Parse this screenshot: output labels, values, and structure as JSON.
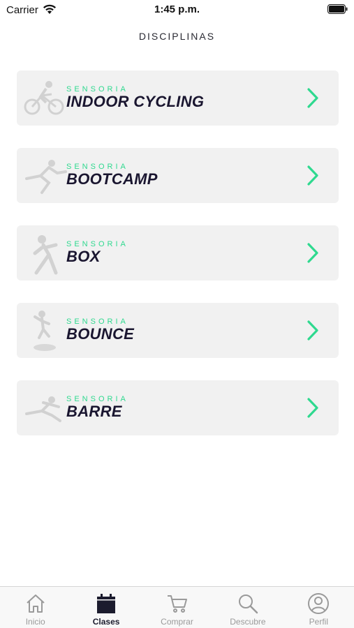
{
  "status_bar": {
    "carrier": "Carrier",
    "time": "1:45 p.m."
  },
  "header": {
    "title": "DISCIPLINAS"
  },
  "disciplines": [
    {
      "brand": "SENSORIA",
      "name": "INDOOR CYCLING",
      "icon": "cyclist-figure"
    },
    {
      "brand": "SENSORIA",
      "name": "BOOTCAMP",
      "icon": "runner-figure"
    },
    {
      "brand": "SENSORIA",
      "name": "BOX",
      "icon": "boxer-figure"
    },
    {
      "brand": "SENSORIA",
      "name": "BOUNCE",
      "icon": "trampoline-figure"
    },
    {
      "brand": "SENSORIA",
      "name": "BARRE",
      "icon": "dancer-figure"
    }
  ],
  "tab_bar": {
    "tabs": [
      {
        "label": "Inicio",
        "icon": "home-icon",
        "active": false
      },
      {
        "label": "Clases",
        "icon": "calendar-icon",
        "active": true
      },
      {
        "label": "Comprar",
        "icon": "cart-icon",
        "active": false
      },
      {
        "label": "Descubre",
        "icon": "search-icon",
        "active": false
      },
      {
        "label": "Perfil",
        "icon": "profile-icon",
        "active": false
      }
    ]
  },
  "colors": {
    "accent": "#2fd98f",
    "title_text": "#1a1630",
    "card_bg": "#f1f1f1",
    "tab_active": "#1c1c2e",
    "tab_inactive": "#9a9a9a"
  }
}
